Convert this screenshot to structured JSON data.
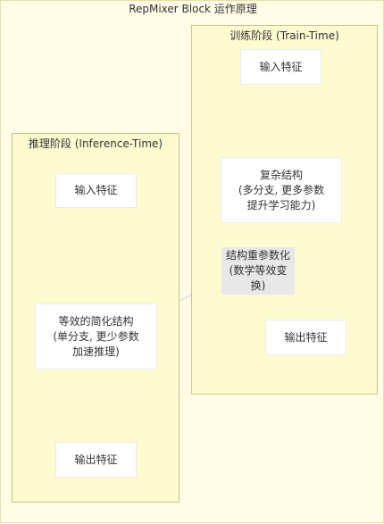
{
  "title": "RepMixer Block 运作原理",
  "groups": {
    "train": {
      "label": "训练阶段 (Train-Time)",
      "nodes": {
        "input": "输入特征",
        "complex": "复杂结构\n(多分支, 更多参数\n提升学习能力)",
        "output": "输出特征"
      }
    },
    "inference": {
      "label": "推理阶段 (Inference-Time)",
      "nodes": {
        "input": "输入特征",
        "simple": "等效的简化结构\n(单分支, 更少参数\n加速推理)",
        "output": "输出特征"
      }
    }
  },
  "edge_label": "结构重参数化\n(数学等效变换)",
  "colors": {
    "background": "#fffde7",
    "group_fill": "#fffbd0",
    "group_border": "#c9c48a",
    "node_fill": "#ffffff",
    "edge": "#d6d6d6"
  }
}
